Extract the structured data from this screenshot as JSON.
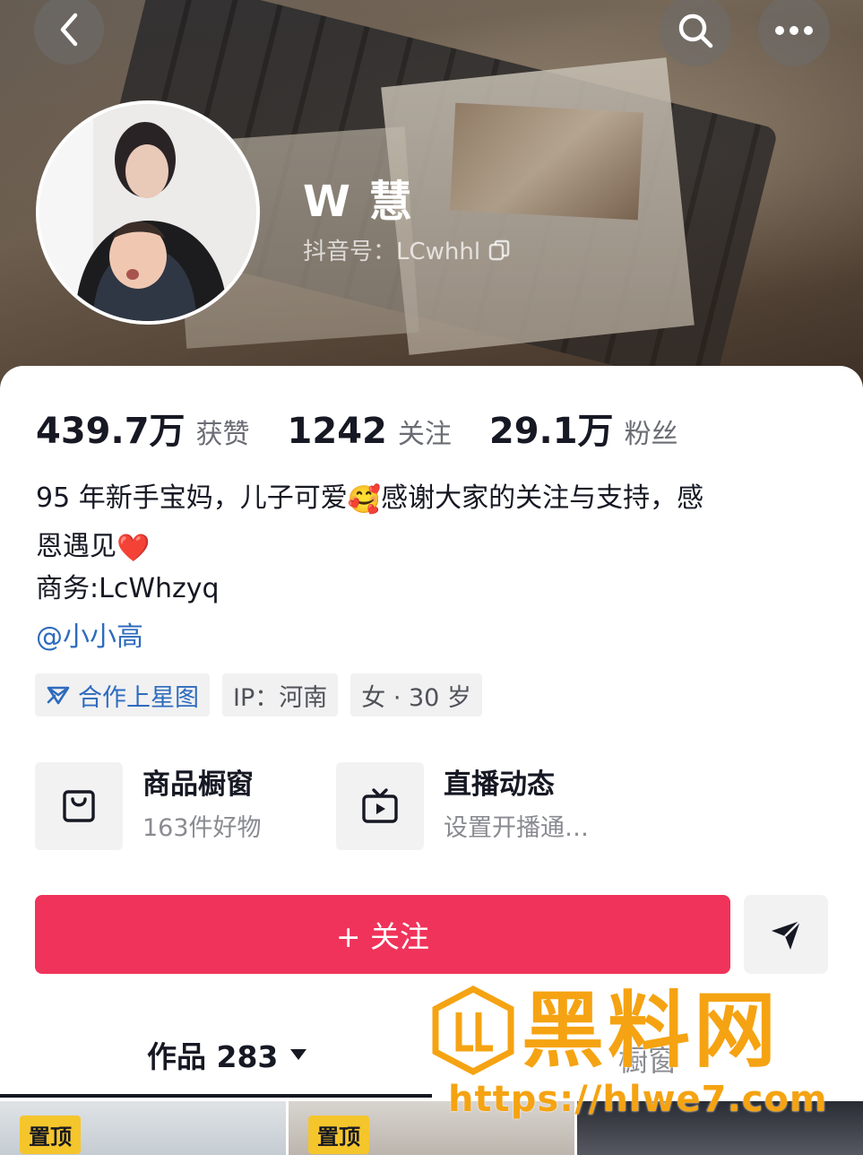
{
  "profile": {
    "name": "W 慧",
    "douyin_id": "抖音号：LCwhhl"
  },
  "stats": [
    {
      "value": "439.7万",
      "label": "获赞"
    },
    {
      "value": "1242",
      "label": "关注"
    },
    {
      "value": "29.1万",
      "label": "粉丝"
    }
  ],
  "bio": {
    "line1_part1": "95 年新手宝妈，儿子可爱",
    "line1_emoji": "🥰",
    "line1_part2": "感谢大家的关注与支持，感",
    "line2_part1": "恩遇见",
    "line2_emoji": "❤️",
    "business": "商务:LcWhzyq",
    "mention": "@小小高"
  },
  "tags": {
    "star": "合作上星图",
    "ip": "IP：河南",
    "gender_age": "女 · 30 岁"
  },
  "services": [
    {
      "title": "商品橱窗",
      "subtitle": "163件好物",
      "icon": "shopping-bag-icon"
    },
    {
      "title": "直播动态",
      "subtitle": "设置开播通…",
      "icon": "tv-play-icon"
    }
  ],
  "actions": {
    "follow_label": "+ 关注",
    "share_icon": "send-icon"
  },
  "tabs": {
    "works_label": "作品 283",
    "other_label": "橱窗"
  },
  "thumbnails": [
    {
      "badge": "置顶"
    },
    {
      "badge": "置顶"
    },
    {
      "badge": ""
    }
  ],
  "watermark": {
    "text": "黑料网",
    "url": "https://hlwe7.com"
  },
  "colors": {
    "accent": "#f0335a",
    "link": "#2e6bbd",
    "pin_badge": "#f5c52c",
    "watermark": "#f5a312"
  }
}
